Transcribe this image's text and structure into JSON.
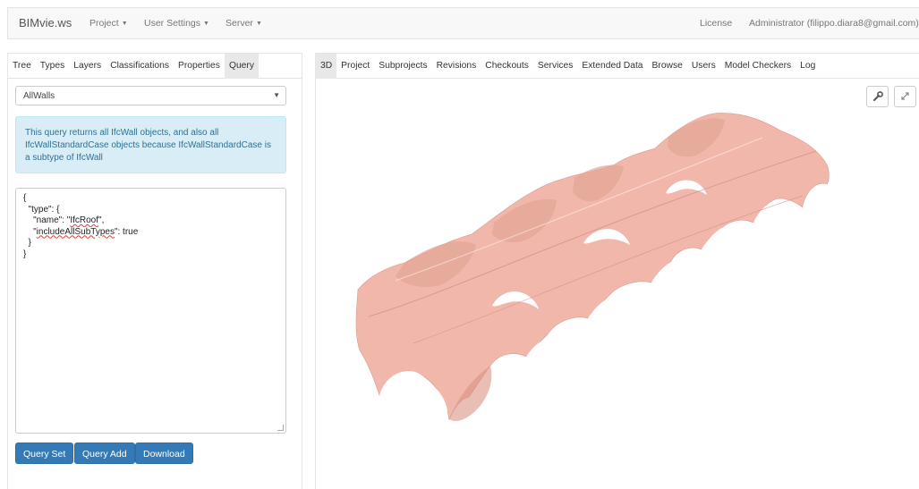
{
  "navbar": {
    "brand": "BIMvie.ws",
    "project": "Project",
    "user_settings": "User Settings",
    "server": "Server",
    "license": "License",
    "user": "Administrator (filippo.diara8@gmail.com)"
  },
  "left": {
    "tabs": [
      "Tree",
      "Types",
      "Layers",
      "Classifications",
      "Properties",
      "Query"
    ],
    "active_tab": "Query",
    "select_value": "AllWalls",
    "info": "This query returns all IfcWall objects, and also all IfcWallStandardCase objects because IfcWallStandardCase is a subtype of IfcWall",
    "editor": {
      "l1": "{",
      "l2": "  \"type\": {",
      "l3_a": "    \"name\": \"",
      "l3_b": "IfcRoof",
      "l3_c": "\",",
      "l4_a": "    \"",
      "l4_b": "includeAllSubTypes",
      "l4_c": "\": true",
      "l5": "  }",
      "l6": "}"
    },
    "buttons": {
      "query_set": "Query Set",
      "query_add": "Query Add",
      "download": "Download"
    }
  },
  "right": {
    "tabs": [
      "3D",
      "Project",
      "Subprojects",
      "Revisions",
      "Checkouts",
      "Services",
      "Extended Data",
      "Browse",
      "Users",
      "Model Checkers",
      "Log"
    ],
    "tools": [
      "wrench-icon",
      "expand-icon"
    ],
    "model_color": "#f2b7ab"
  }
}
